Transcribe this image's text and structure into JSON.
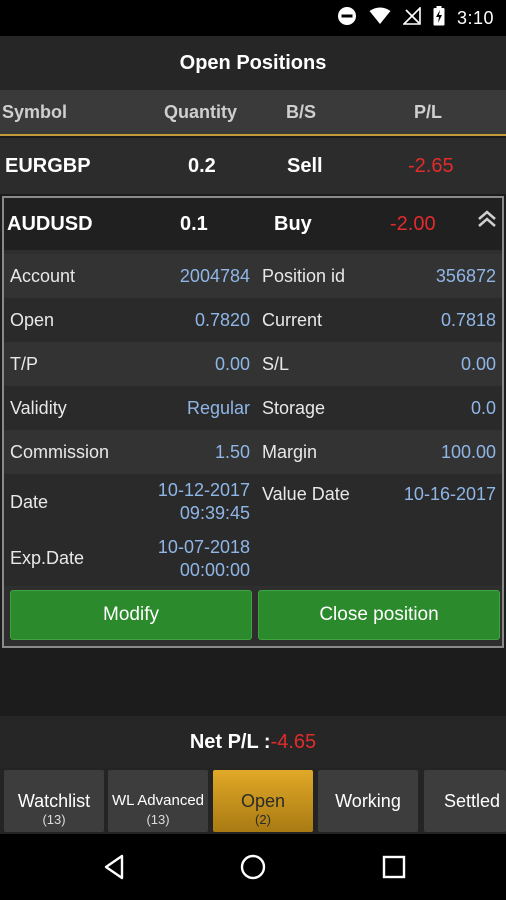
{
  "status_bar": {
    "time": "3:10",
    "icons": [
      "dnd-icon",
      "wifi-icon",
      "no-signal-icon",
      "battery-charging-icon"
    ]
  },
  "header": {
    "title": "Open Positions"
  },
  "columns": {
    "symbol": "Symbol",
    "quantity": "Quantity",
    "bs": "B/S",
    "pl": "P/L"
  },
  "positions": [
    {
      "symbol": "EURGBP",
      "quantity": "0.2",
      "side": "Sell",
      "pl": "-2.65"
    },
    {
      "symbol": "AUDUSD",
      "quantity": "0.1",
      "side": "Buy",
      "pl": "-2.00"
    }
  ],
  "details": {
    "account_label": "Account",
    "account_value": "2004784",
    "position_id_label": "Position id",
    "position_id_value": "356872",
    "open_label": "Open",
    "open_value": "0.7820",
    "current_label": "Current",
    "current_value": "0.7818",
    "tp_label": "T/P",
    "tp_value": "0.00",
    "sl_label": "S/L",
    "sl_value": "0.00",
    "validity_label": "Validity",
    "validity_value": "Regular",
    "storage_label": "Storage",
    "storage_value": "0.0",
    "commission_label": "Commission",
    "commission_value": "1.50",
    "margin_label": "Margin",
    "margin_value": "100.00",
    "date_label": "Date",
    "date_value_date": "10-12-2017",
    "date_value_time": "09:39:45",
    "value_date_label": "Value Date",
    "value_date_value": "10-16-2017",
    "exp_date_label": "Exp.Date",
    "exp_date_value_date": "10-07-2018",
    "exp_date_value_time": "00:00:00"
  },
  "buttons": {
    "modify": "Modify",
    "close": "Close position"
  },
  "net_pl": {
    "label": "Net P/L :",
    "value": "-4.65"
  },
  "tabs": [
    {
      "label": "Watchlist",
      "count": "(13)"
    },
    {
      "label": "WL Advanced",
      "count": "(13)"
    },
    {
      "label": "Open",
      "count": "(2)"
    },
    {
      "label": "Working",
      "count": ""
    },
    {
      "label": "Settled",
      "count": ""
    }
  ],
  "colors": {
    "accent": "#c49a3a",
    "negative": "#e22b2b",
    "value": "#8fb6e6",
    "button": "#2b8a2b",
    "active_tab": "#e1a928"
  }
}
